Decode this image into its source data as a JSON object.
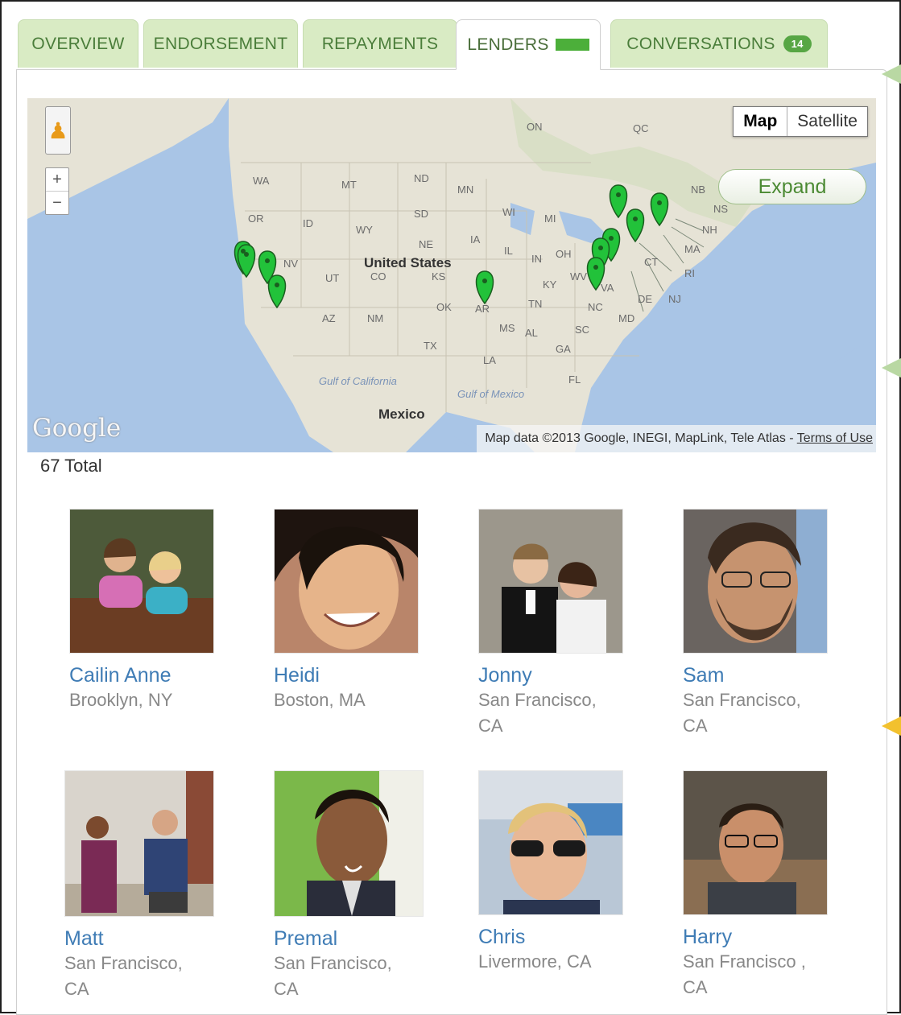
{
  "tabs": [
    {
      "label": "OVERVIEW"
    },
    {
      "label": "ENDORSEMENT"
    },
    {
      "label": "REPAYMENTS"
    },
    {
      "label": "LENDERS"
    },
    {
      "label": "CONVERSATIONS",
      "count": "14"
    }
  ],
  "map": {
    "type_buttons": [
      "Map",
      "Satellite"
    ],
    "expand_label": "Expand",
    "zoom_in": "+",
    "zoom_out": "−",
    "logo": "Google",
    "attribution": "Map data ©2013 Google, INEGI, MapLink, Tele Atlas - ",
    "terms_link": "Terms of Use",
    "country_label": "United States",
    "mexico_label": "Mexico",
    "gulf_california": "Gulf of California",
    "gulf_mexico": "Gulf of Mexico",
    "state_labels": [
      "WA",
      "MT",
      "ND",
      "MN",
      "OR",
      "ID",
      "WY",
      "SD",
      "NE",
      "IA",
      "NV",
      "UT",
      "CO",
      "KS",
      "AZ",
      "NM",
      "OK",
      "TX",
      "LA",
      "MS",
      "AL",
      "TN",
      "KY",
      "IN",
      "OH",
      "WI",
      "MI",
      "IL",
      "AR",
      "GA",
      "SC",
      "NC",
      "FL",
      "VA",
      "WV",
      "MD",
      "DE",
      "NJ",
      "CT",
      "RI",
      "MA",
      "NH",
      "NB",
      "NS",
      "ON",
      "QC"
    ]
  },
  "lenders_total": "67 Total",
  "lenders": [
    {
      "name": "Cailin Anne",
      "location": "Brooklyn, NY"
    },
    {
      "name": "Heidi",
      "location": "Boston, MA"
    },
    {
      "name": "Jonny",
      "location": "San Francisco, CA"
    },
    {
      "name": "Sam",
      "location": "San Francisco, CA"
    },
    {
      "name": "Matt",
      "location": "San Francisco, CA"
    },
    {
      "name": "Premal",
      "location": "San Francisco, CA"
    },
    {
      "name": "Chris",
      "location": "Livermore, CA"
    },
    {
      "name": "Harry",
      "location": "San Francisco , CA"
    }
  ],
  "colors": {
    "tab_bg": "#d9ebc4",
    "tab_text": "#4a7d3a",
    "link": "#3f7cb5",
    "marker": "#22c23a"
  }
}
